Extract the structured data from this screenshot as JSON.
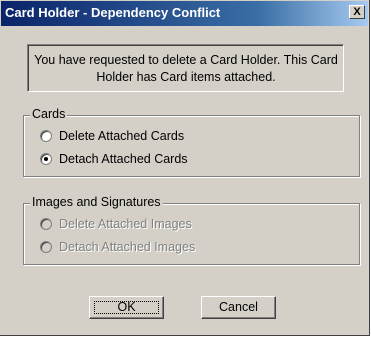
{
  "window": {
    "title": "Card Holder - Dependency Conflict",
    "close_label": "X"
  },
  "message": "You have requested to delete a Card Holder. This Card Holder has Card items attached.",
  "cards_group": {
    "legend": "Cards",
    "options": [
      {
        "label": "Delete Attached Cards",
        "selected": false
      },
      {
        "label": "Detach Attached Cards",
        "selected": true
      }
    ]
  },
  "images_group": {
    "legend": "Images and Signatures",
    "disabled": true,
    "options": [
      {
        "label": "Delete Attached Images",
        "selected": false
      },
      {
        "label": "Detach Attached Images",
        "selected": false
      }
    ]
  },
  "buttons": {
    "ok_label": "OK",
    "cancel_label": "Cancel"
  }
}
